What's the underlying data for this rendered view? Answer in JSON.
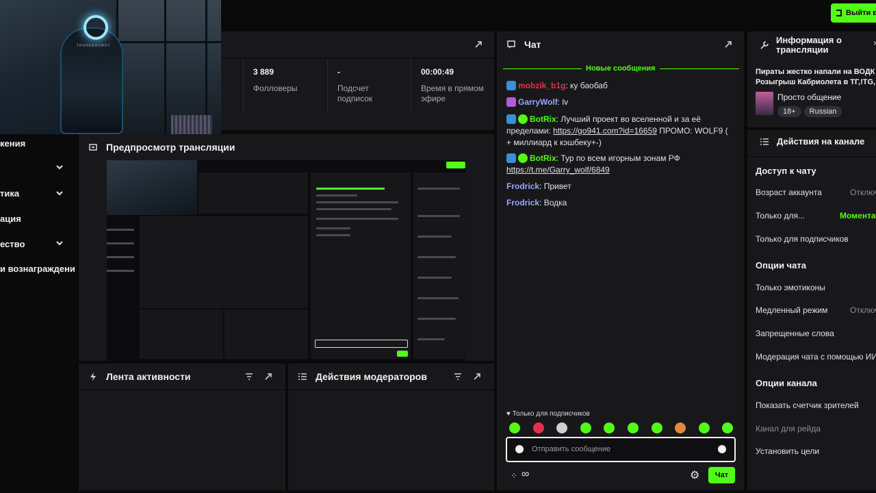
{
  "top_button": {
    "label": "Выйти в"
  },
  "webcam": {
    "brand": "THUNDEROBOT"
  },
  "stats": {
    "followers_value": "3 889",
    "followers_label": "Фолловеры",
    "subs_value": "-",
    "subs_label": "Подсчет подписок",
    "live_value": "00:00:49",
    "live_label": "Время в прямом эфире"
  },
  "sidebar": {
    "items": [
      {
        "label": "кения",
        "chevron": false
      },
      {
        "label": "",
        "chevron": true
      },
      {
        "label": "тика",
        "chevron": true
      },
      {
        "label": "ация",
        "chevron": false
      },
      {
        "label": "ество",
        "chevron": true
      },
      {
        "label": "и вознаграждени",
        "chevron": false
      }
    ]
  },
  "preview": {
    "title": "Предпросмотр трансляции"
  },
  "activity": {
    "title": "Лента активности"
  },
  "moderators": {
    "title": "Действия модераторов"
  },
  "chat": {
    "title": "Чат",
    "new_messages": "Новые сообщения",
    "messages": [
      {
        "user": "mobzik_b1g",
        "color": "#e0334a",
        "badge": "#3a8fd6",
        "verified": false,
        "text": "ку баобаб"
      },
      {
        "user": "GarryWolf",
        "color": "#9aa6ff",
        "badge": "#b05cd8",
        "verified": false,
        "text": "lv"
      },
      {
        "user": "BotRix",
        "color": "#53fc18",
        "badge": "#3a8fd6",
        "verified": true,
        "text": "Лучший проект во вселенной и за её пределами: ",
        "link": "https://go941.com?id=16659",
        "text2": " ПРОМО: WOLF9 ( + миллиард к кэшбеку+-)"
      },
      {
        "user": "BotRix",
        "color": "#53fc18",
        "badge": "#3a8fd6",
        "verified": true,
        "text": "Тур по всем игорным зонам РФ ",
        "link": "https://t.me/Garry_wolf/6849",
        "text2": ""
      },
      {
        "user": "Frodrick",
        "color": "#9aa6ff",
        "badge": "",
        "verified": false,
        "text": "Привет"
      },
      {
        "user": "Frodrick",
        "color": "#9aa6ff",
        "badge": "",
        "verified": false,
        "text": "Водка"
      }
    ],
    "subs_only": "Только для подписчиков",
    "input_placeholder": "Отправить сообщение",
    "send_label": "Чат",
    "emotes": [
      "#53fc18",
      "#e0334a",
      "#cfcfcf",
      "#53fc18",
      "#53fc18",
      "#53fc18",
      "#53fc18",
      "#e08a3a",
      "#53fc18",
      "#53fc18"
    ]
  },
  "info": {
    "title": "Информация о трансляции",
    "stream_title": "Пираты жестко напали на ВОДК Розыгрыш Кабриолета в ТГ,!TG,",
    "category": "Просто общение",
    "tags": [
      "18+",
      "Russian"
    ]
  },
  "actions": {
    "title": "Действия на канале",
    "chat_access": "Доступ к чату",
    "account_age": "Возраст аккаунта",
    "account_age_value": "Отключ",
    "only_for": "Только для...",
    "only_for_value": "Моментал",
    "subs_only": "Только для подписчиков",
    "chat_options": "Опции чата",
    "emotes_only": "Только эмотиконы",
    "slow_mode": "Медленный режим",
    "slow_mode_value": "Отключ",
    "banned_words": "Запрещенные слова",
    "ai_moderation": "Модерация чата с помощью ИИ",
    "channel_options": "Опции канала",
    "show_viewers": "Показать счетчик зрителей",
    "raid_channel": "Канал для рейда",
    "set_goals": "Установить цели"
  },
  "colors": {
    "accent": "#53fc18",
    "panel": "#18181b",
    "bg": "#0a0a0b"
  }
}
